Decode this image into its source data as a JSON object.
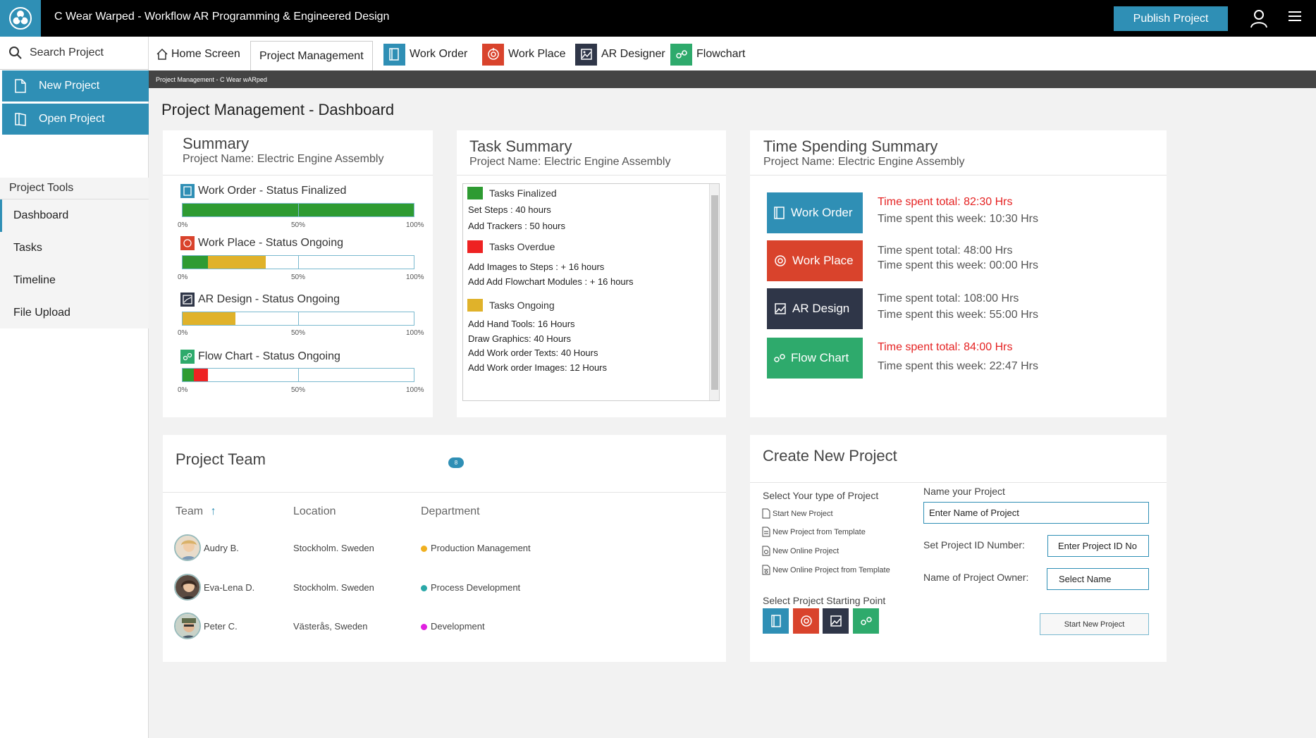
{
  "app": {
    "title": "C Wear Warped - Workflow AR Programming & Engineered Design",
    "publish_label": "Publish Project"
  },
  "colors": {
    "accent": "#2f8fb5",
    "work_order": "#2f8fb5",
    "work_place": "#d9432c",
    "ar_design": "#2f3648",
    "flow_chart": "#2eaa6c",
    "green": "#2e9b32",
    "yellow": "#e0b22a",
    "red": "#ee2222",
    "magenta": "#e020e0"
  },
  "sidebar": {
    "search_label": "Search Project",
    "new_project": "New Project",
    "open_project": "Open Project",
    "tools_title": "Project Tools",
    "items": [
      {
        "label": "Dashboard"
      },
      {
        "label": "Tasks"
      },
      {
        "label": "Timeline"
      },
      {
        "label": "File Upload"
      }
    ]
  },
  "tabs": [
    {
      "label": "Home Screen",
      "icon": "home-icon"
    },
    {
      "label": "Project Management"
    },
    {
      "label": "Work Order",
      "icon": "work-order-icon"
    },
    {
      "label": "Work Place",
      "icon": "work-place-icon"
    },
    {
      "label": "AR Designer",
      "icon": "ar-designer-icon"
    },
    {
      "label": "Flowchart",
      "icon": "flowchart-icon"
    }
  ],
  "breadcrumb": "Project Management - C Wear wARped",
  "page_title": "Project Management - Dashboard",
  "summary": {
    "title": "Summary",
    "subtitle": "Project Name: Electric Engine Assembly",
    "ticks": [
      "0%",
      "50%",
      "100%"
    ],
    "bars": [
      {
        "label": "Work Order -  Status Finalized",
        "segments": [
          {
            "color": "green",
            "fraction": 1.0
          }
        ]
      },
      {
        "label": "Work Place - Status Ongoing",
        "segments": [
          {
            "color": "green",
            "fraction": 0.11
          },
          {
            "color": "yellow",
            "fraction": 0.25
          }
        ]
      },
      {
        "label": "AR Design - Status Ongoing",
        "segments": [
          {
            "color": "yellow",
            "fraction": 0.23
          }
        ]
      },
      {
        "label": "Flow Chart - Status Ongoing",
        "segments": [
          {
            "color": "green",
            "fraction": 0.05
          },
          {
            "color": "red",
            "fraction": 0.06
          }
        ]
      }
    ]
  },
  "task_summary": {
    "title": "Task Summary",
    "subtitle": "Project Name: Electric Engine Assembly",
    "groups": [
      {
        "label": "Tasks Finalized",
        "color": "green",
        "items": [
          "Set Steps : 40 hours",
          "Add Trackers : 50 hours"
        ]
      },
      {
        "label": "Tasks Overdue",
        "color": "red",
        "items": [
          "Add Images to Steps : + 16 hours",
          "Add Add Flowchart Modules : + 16 hours"
        ]
      },
      {
        "label": "Tasks Ongoing",
        "color": "yellow",
        "items": [
          "Add Hand Tools: 16 Hours",
          "Draw Graphics: 40 Hours",
          "Add Work order Texts: 40 Hours",
          "Add Work order Images: 12 Hours"
        ]
      }
    ]
  },
  "time_summary": {
    "title": "Time Spending Summary",
    "subtitle": "Project Name: Electric Engine Assembly",
    "rows": [
      {
        "label": "Work Order",
        "total": "Time spent total: 82:30 Hrs",
        "week": "Time spent this week: 10:30 Hrs",
        "total_red": true
      },
      {
        "label": "Work Place",
        "total": "Time spent total: 48:00 Hrs",
        "week": "Time spent this week: 00:00 Hrs",
        "total_red": false
      },
      {
        "label": "AR Design",
        "total": "Time spent total: 108:00 Hrs",
        "week": "Time spent this week: 55:00 Hrs",
        "total_red": false
      },
      {
        "label": "Flow Chart",
        "total": "Time spent total: 84:00 Hrs",
        "week": "Time spent this week: 22:47 Hrs",
        "total_red": true
      }
    ]
  },
  "team": {
    "title": "Project Team",
    "badge": "8",
    "columns": [
      "Team",
      "Location",
      "Department"
    ],
    "sort_icon": "arrow-up-icon",
    "members": [
      {
        "name": "Audry B.",
        "location": "Stockholm. Sweden",
        "department": "Production Management",
        "dot_color": "#f0b020"
      },
      {
        "name": "Eva-Lena D.",
        "location": "Stockholm. Sweden",
        "department": "Process Development",
        "dot_color": "#2aa8a8"
      },
      {
        "name": "Peter C.",
        "location": "Västerås, Sweden",
        "department": "Development",
        "dot_color": "#e020e0"
      }
    ]
  },
  "create": {
    "title": "Create New Project",
    "type_label": "Select Your type of Project",
    "options": [
      "Start New Project",
      "New Project from Template",
      "New Online Project",
      "New Online Project from Template"
    ],
    "starting_point_label": "Select Project Starting Point",
    "name_label": "Name your Project",
    "name_value": "Enter Name of Project",
    "id_label": "Set Project ID Number:",
    "id_value": "Enter Project ID No",
    "owner_label": "Name of Project Owner:",
    "owner_value": "Select Name",
    "start_button": "Start New Project"
  }
}
